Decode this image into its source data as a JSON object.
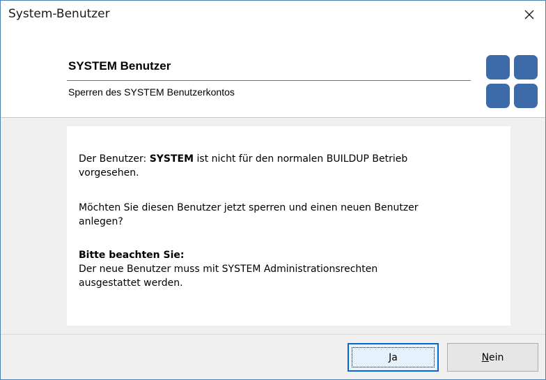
{
  "window": {
    "title": "System-Benutzer",
    "close_glyph": "✕"
  },
  "header": {
    "title": "SYSTEM Benutzer",
    "subtitle": "Sperren des SYSTEM Benutzerkontos",
    "logo_icon": "four-squares-logo",
    "logo_color": "#3d6aa8",
    "rule_color": "#3b7cc4"
  },
  "message": {
    "p1_prefix": "Der Benutzer: ",
    "p1_user": "SYSTEM",
    "p1_suffix_line1": " ist nicht für den normalen BUILDUP Betrieb",
    "p1_line2": "vorgesehen.",
    "p2_line1": "Möchten Sie diesen Benutzer jetzt sperren und einen neuen Benutzer",
    "p2_line2": "anlegen?",
    "note_heading": "Bitte beachten Sie:",
    "note_line1": "Der neue Benutzer muss mit SYSTEM Administrationsrechten",
    "note_line2": "ausgestattet werden."
  },
  "buttons": {
    "yes": {
      "accel": "J",
      "rest": "a"
    },
    "no": {
      "accel": "N",
      "rest": "ein"
    }
  }
}
